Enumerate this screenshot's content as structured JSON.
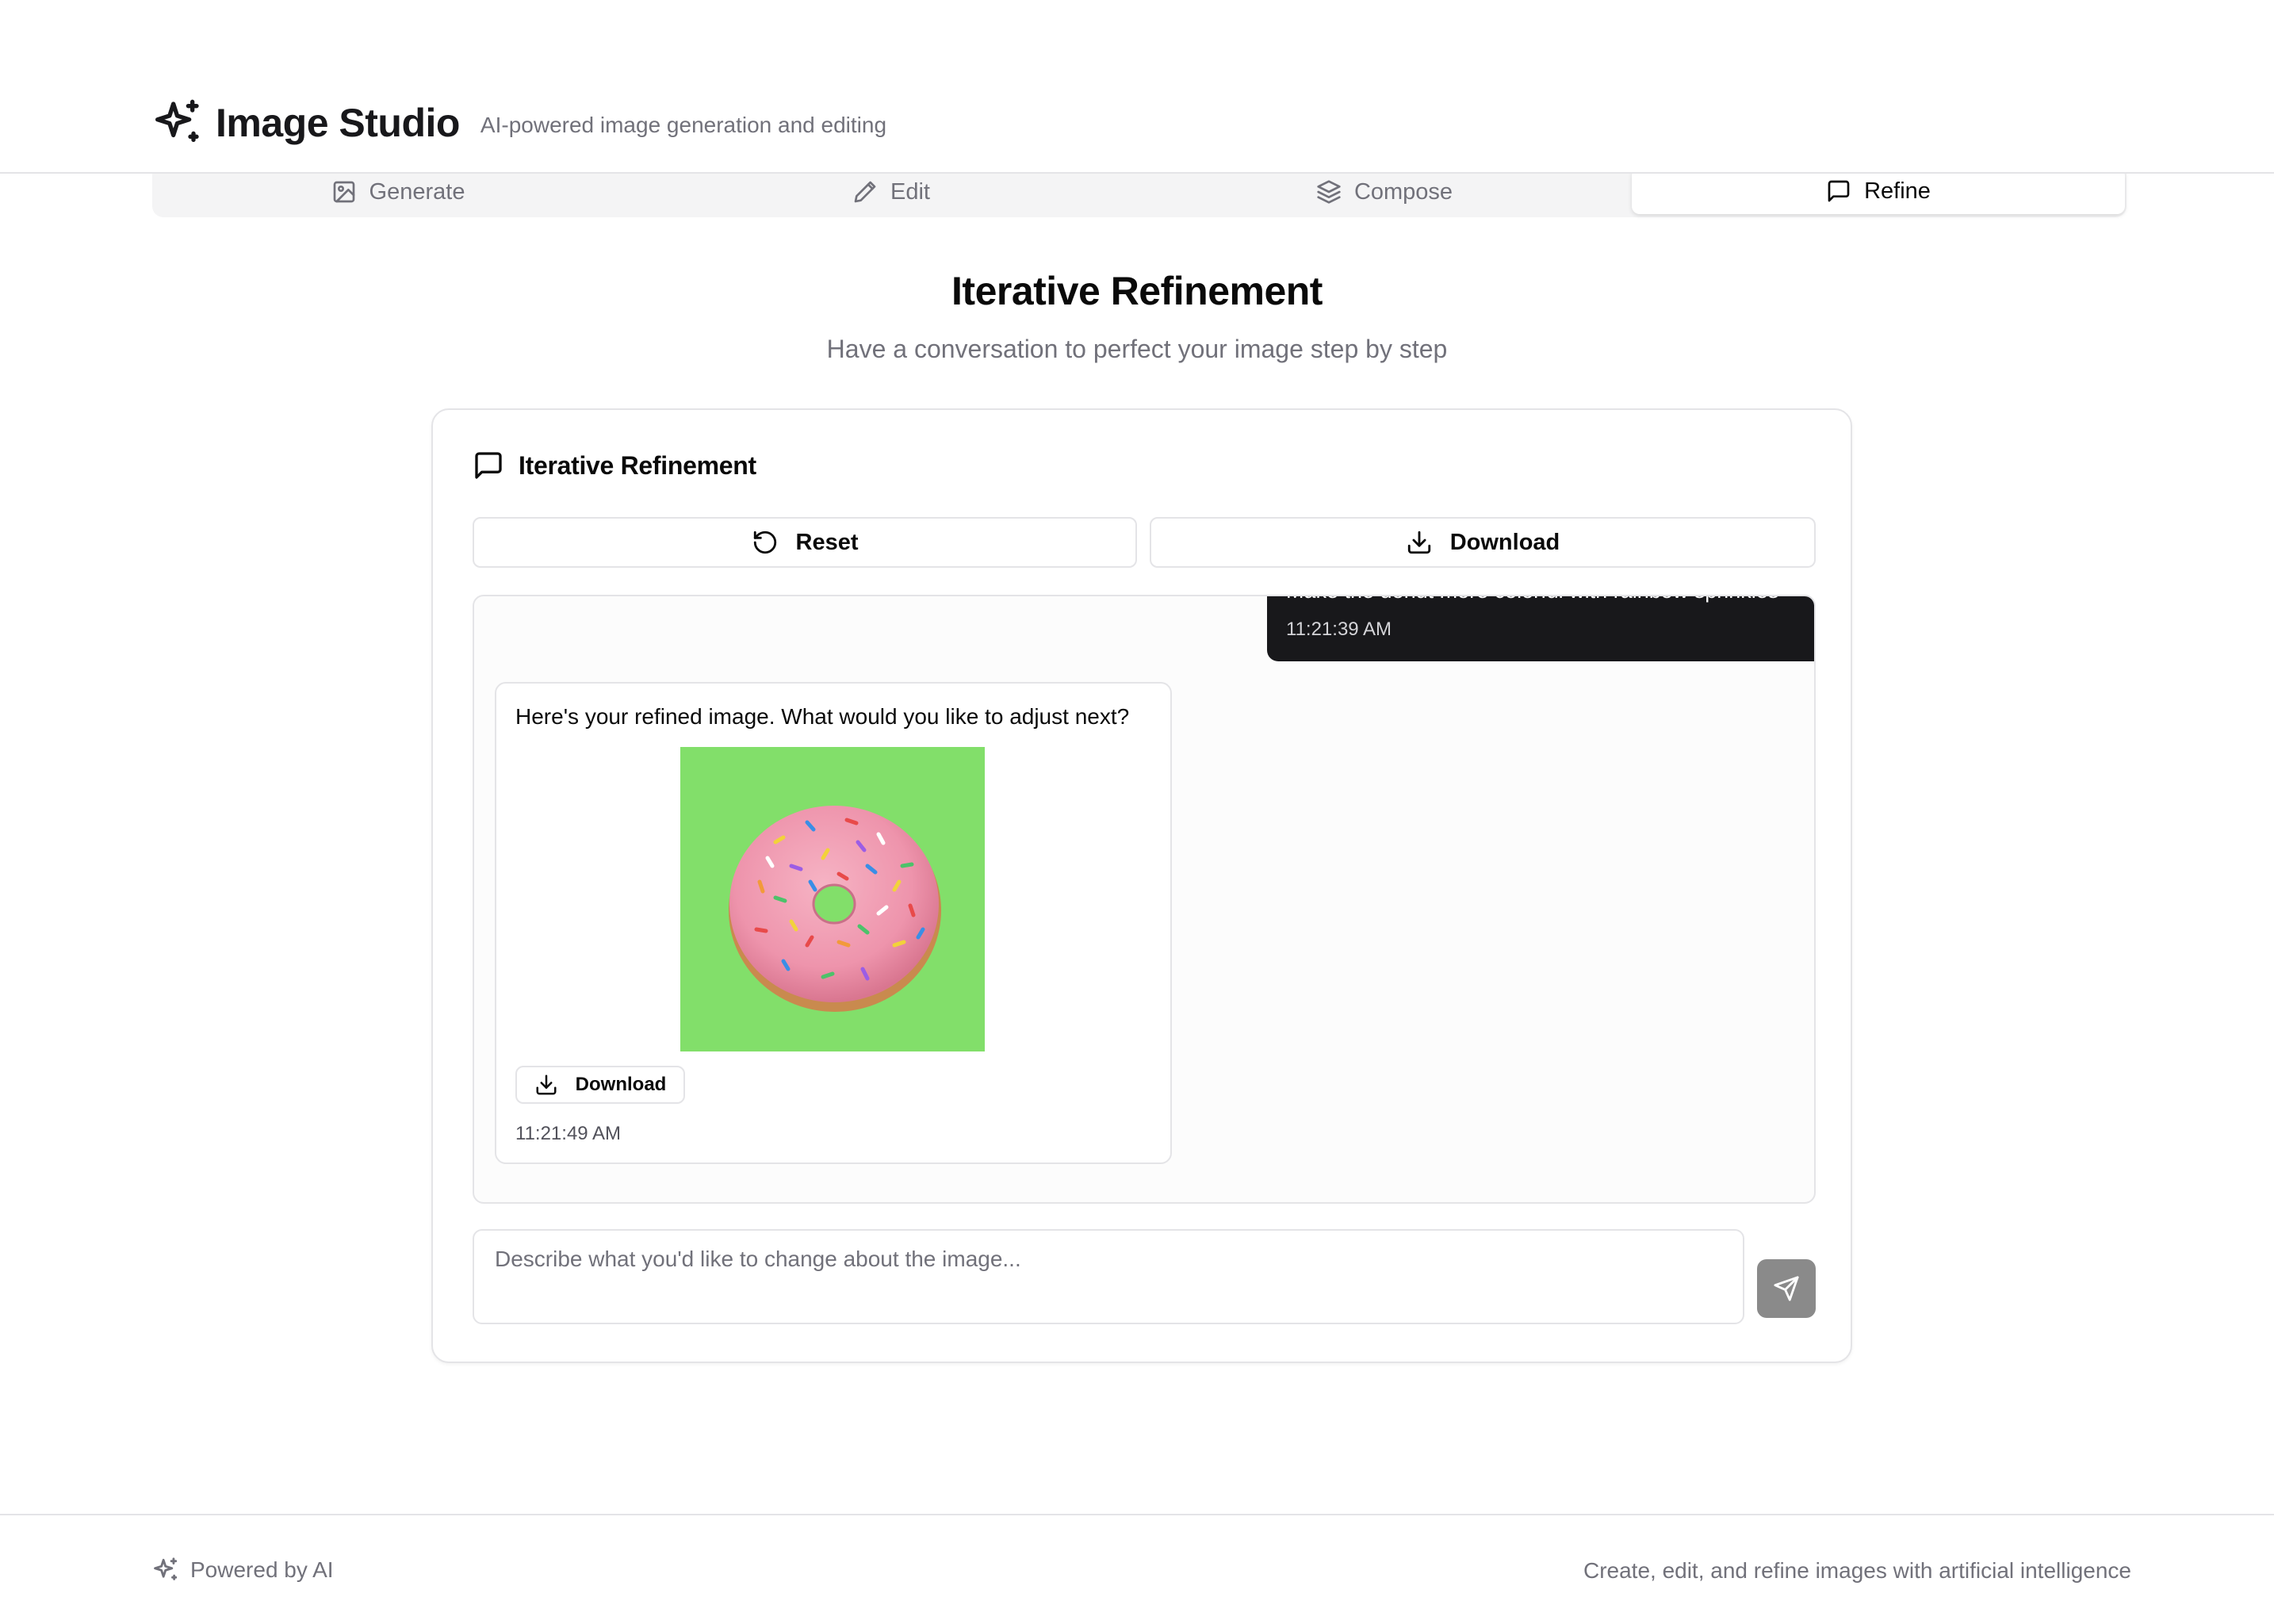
{
  "header": {
    "title": "Image Studio",
    "subtitle": "AI-powered image generation and editing"
  },
  "tabs": [
    {
      "label": "Generate",
      "icon": "image-icon"
    },
    {
      "label": "Edit",
      "icon": "pencil-icon"
    },
    {
      "label": "Compose",
      "icon": "layers-icon"
    },
    {
      "label": "Refine",
      "icon": "message-square-icon",
      "active": true
    }
  ],
  "page": {
    "title": "Iterative Refinement",
    "subtitle": "Have a conversation to perfect your image step by step"
  },
  "card": {
    "title": "Iterative Refinement",
    "reset_label": "Reset",
    "download_label": "Download"
  },
  "chat": {
    "user_message": {
      "text": "Make the donut more colorful with rainbow sprinkles",
      "time": "11:21:39 AM"
    },
    "ai_message": {
      "text": "Here's your refined image. What would you like to adjust next?",
      "image_background": "#82df6a",
      "download_label": "Download",
      "time": "11:21:49 AM"
    }
  },
  "input": {
    "placeholder": "Describe what you'd like to change about the image...",
    "value": ""
  },
  "footer": {
    "left": "Powered by AI",
    "right": "Create, edit, and refine images with artificial intelligence"
  },
  "colors": {
    "accent_dark": "#18181b",
    "muted_text": "#71717a",
    "border": "#e4e4e7",
    "send_button": "#8a8a8a"
  }
}
